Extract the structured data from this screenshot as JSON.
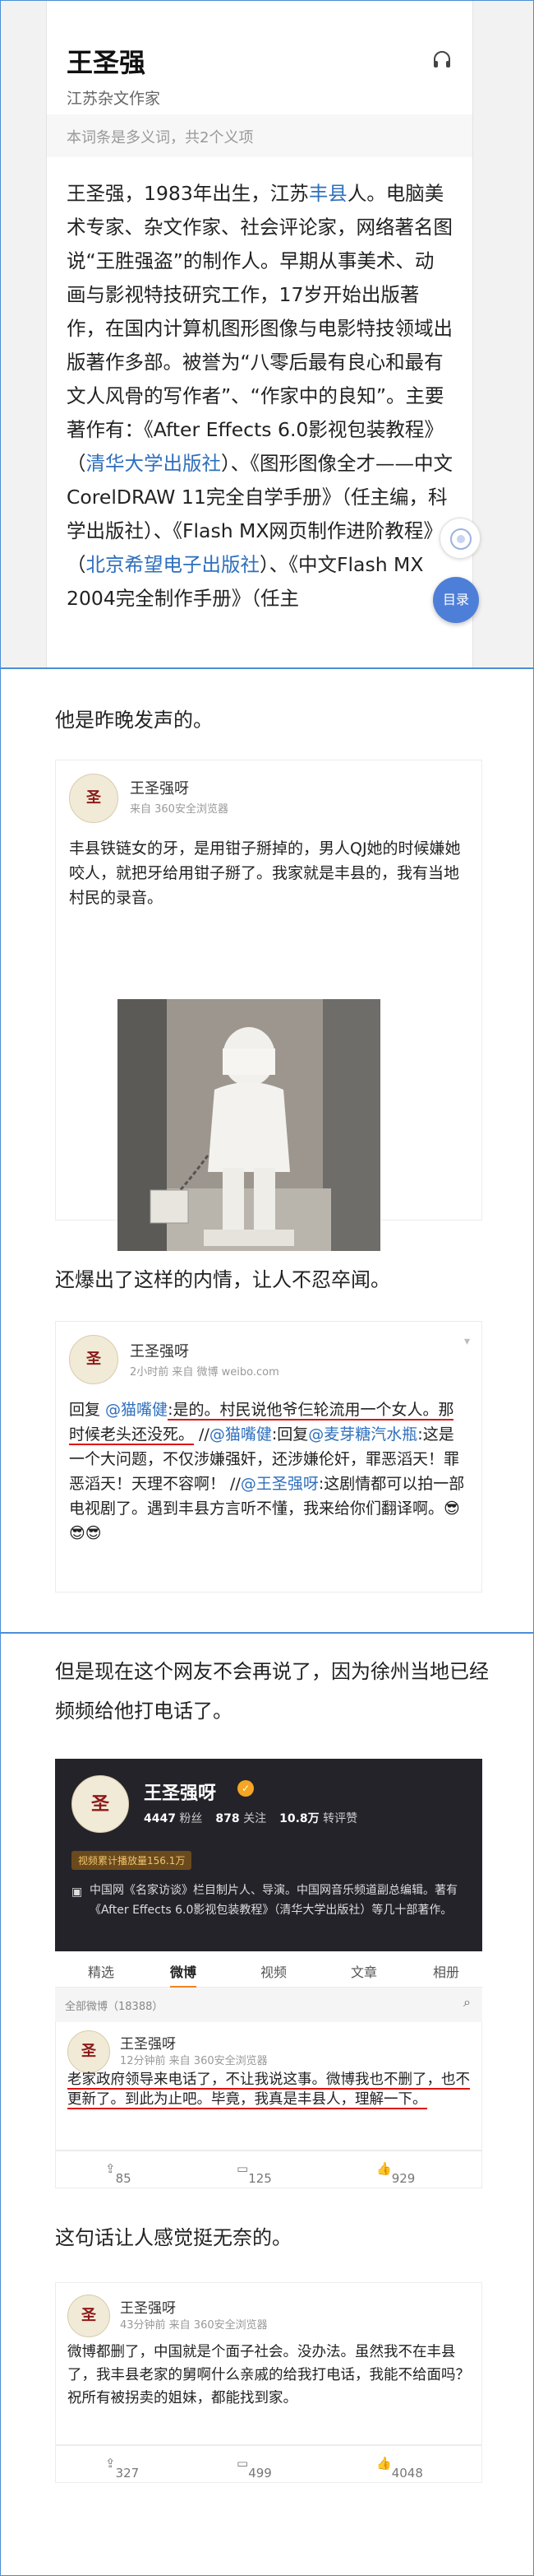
{
  "panel1": {
    "title": "王圣强",
    "subtitle": "江苏杂文作家",
    "audio_icon": "headphones-icon",
    "polysemy_note": "本词条是多义词，共2个义项",
    "toc_label": "目录",
    "body": [
      {
        "t": "王圣强，1983年出生，江苏"
      },
      {
        "t": "丰县",
        "link": true
      },
      {
        "t": "人。电脑美术专家、杂文作家、社会评论家，网络著名图说“王胜强盗”的制作人。早期从事美术、动画与影视特技研究工作，17岁开始出版著作，在国内计算机图形图像与电影特技领域出版著作多部。被誉为“八零后最有良心和最有文人风骨的写作者”、“作家中的良知”。主要著作有：《After Effects 6.0影视包装教程》（"
      },
      {
        "t": "清华大学出版社",
        "link": true
      },
      {
        "t": "）、《图形图像全才——中文CorelDRAW 11完全自学手册》（任主编，科学出版社）、《Flash MX网页制作进阶教程》（"
      },
      {
        "t": "北京希望电子出版社",
        "link": true
      },
      {
        "t": "）、《中文Flash MX 2004完全制作手册》（任主"
      }
    ]
  },
  "panel2": {
    "caption1": "他是昨晚发声的。",
    "post1": {
      "avatar_text": "圣",
      "name": "王圣强呀",
      "meta": "来自 360安全浏览器",
      "text": "丰县铁链女的牙，是用钳子掰掉的，男人QJ她的时候嫌她咬人，就把牙给用钳子掰了。我家就是丰县的，我有当地村民的录音。"
    },
    "caption2": "还爆出了这样的内情，让人不忍卒闻。",
    "post2": {
      "avatar_text": "圣",
      "name": "王圣强呀",
      "meta": "2小时前 来自 微博 weibo.com",
      "segments": [
        {
          "t": "回复 "
        },
        {
          "t": "@猫嘴健",
          "link": true
        },
        {
          "t": ":是的。村民说他爷仨轮流用一个女人。",
          "u": true
        },
        {
          "t": "那时候老头还没死。",
          "u": true
        },
        {
          "t": " //"
        },
        {
          "t": "@猫嘴健",
          "link": true
        },
        {
          "t": ":回复"
        },
        {
          "t": "@麦芽糖汽水瓶",
          "link": true
        },
        {
          "t": ":这是一个大问题，不仅涉嫌强奸，还涉嫌伦奸，罪恶滔天！罪恶滔天！天理不容啊！ //"
        },
        {
          "t": "@王圣强呀",
          "link": true
        },
        {
          "t": ":这剧情都可以拍一部电视剧了。遇到丰县方言听不懂，我来给你们翻译啊。😎😎😎"
        }
      ]
    }
  },
  "panel3": {
    "caption1": "但是现在这个网友不会再说了，因为徐州当地已经频频给他打电话了。",
    "profile": {
      "avatar_text": "圣",
      "name": "王圣强呀",
      "stats": [
        {
          "num": "4447",
          "label": "粉丝"
        },
        {
          "num": "878",
          "label": "关注"
        },
        {
          "num": "10.8万",
          "label": "转评赞"
        }
      ],
      "video_badge": "视频累计播放量156.1万",
      "intro": "中国网《名家访谈》栏目制片人、导演。中国网音乐频道副总编辑。著有《After Effects 6.0影视包装教程》（清华大学出版社）等几十部著作。",
      "tabs": [
        "精选",
        "微博",
        "视频",
        "文章",
        "相册"
      ],
      "active_tab": "微博",
      "list_header": "全部微博（18388）",
      "filter_icon": "search-icon"
    },
    "post3": {
      "name": "王圣强呀",
      "meta": "12分钟前 来自 360安全浏览器",
      "text_underlined": "老家政府领导来电话了，不让我说这事。微博我也不删了，也不更新了。到此为止吧。毕竟，我真是丰县人，理解一下。",
      "reposts": "85",
      "comments": "125",
      "likes": "929"
    },
    "caption2": "这句话让人感觉挺无奈的。",
    "post4": {
      "name": "王圣强呀",
      "meta": "43分钟前 来自 360安全浏览器",
      "text": "微博都删了，中国就是个面子社会。没办法。虽然我不在丰县了，我丰县老家的舅啊什么亲戚的给我打电话，我能不给面吗？祝所有被拐卖的姐妹，都能找到家。",
      "reposts": "327",
      "comments": "499",
      "likes": "4048"
    }
  }
}
